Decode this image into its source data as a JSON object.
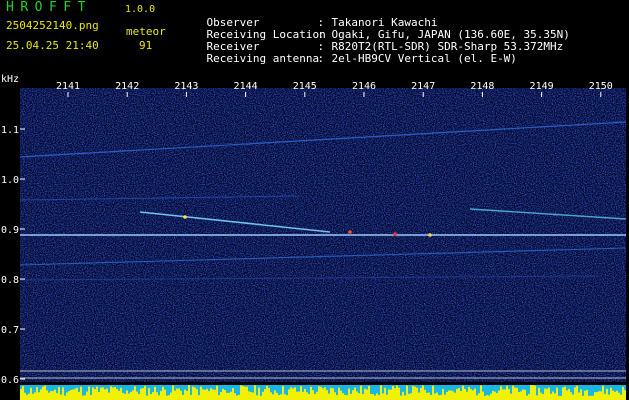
{
  "header": {
    "app_title": "HROFFT",
    "app_version": "1.0.0",
    "file_name": "2504252140.png",
    "datetime": "25.04.25 21:40",
    "meteor_label": "meteor",
    "meteor_count": "91"
  },
  "station_info": [
    {
      "label": "Observer",
      "value": "Takanori Kawachi"
    },
    {
      "label": "Receiving Location",
      "value": "Ogaki, Gifu, JAPAN (136.60E, 35.35N)"
    },
    {
      "label": "Receiver",
      "value": "R820T2(RTL-SDR) SDR-Sharp 53.372MHz"
    },
    {
      "label": "Receiving antenna",
      "value": "2el-HB9CV Vertical (el. E-W)"
    }
  ],
  "spectrogram": {
    "y_unit": "kHz",
    "x_ticks": [
      "2141",
      "2142",
      "2143",
      "2144",
      "2145",
      "2146",
      "2147",
      "2148",
      "2149",
      "2150"
    ],
    "y_ticks": [
      "1.1",
      "1.0",
      "0.9",
      "0.8",
      "0.7",
      "0.6"
    ],
    "colors": {
      "background": "#000000",
      "noise": "#0a1a8c",
      "carrier": "#9bc8ff",
      "level_bar": "#f2f200",
      "level_base": "#19b7e6"
    }
  }
}
